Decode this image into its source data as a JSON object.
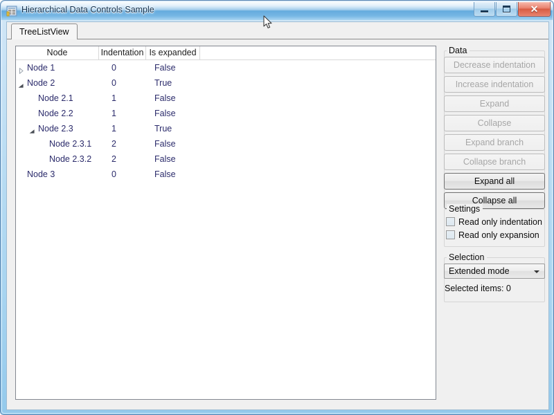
{
  "window": {
    "title": "Hierarchical Data Controls Sample",
    "icon": "table-grid-icon",
    "minimize_label": "",
    "maximize_label": "",
    "close_label": "✕"
  },
  "tabs": [
    {
      "label": "TreeListView",
      "selected": true
    }
  ],
  "treelist": {
    "columns": [
      "Node",
      "Indentation",
      "Is expanded"
    ],
    "rows": [
      {
        "label": "Node 1",
        "indentation": "0",
        "expanded": "False",
        "level": 0,
        "expander": "collapsed"
      },
      {
        "label": "Node 2",
        "indentation": "0",
        "expanded": "True",
        "level": 0,
        "expander": "expanded"
      },
      {
        "label": "Node 2.1",
        "indentation": "1",
        "expanded": "False",
        "level": 1,
        "expander": "none"
      },
      {
        "label": "Node 2.2",
        "indentation": "1",
        "expanded": "False",
        "level": 1,
        "expander": "none"
      },
      {
        "label": "Node 2.3",
        "indentation": "1",
        "expanded": "True",
        "level": 1,
        "expander": "expanded"
      },
      {
        "label": "Node 2.3.1",
        "indentation": "2",
        "expanded": "False",
        "level": 2,
        "expander": "none"
      },
      {
        "label": "Node 2.3.2",
        "indentation": "2",
        "expanded": "False",
        "level": 2,
        "expander": "none"
      },
      {
        "label": "Node 3",
        "indentation": "0",
        "expanded": "False",
        "level": 0,
        "expander": "none"
      }
    ]
  },
  "data_group": {
    "title": "Data",
    "buttons": [
      {
        "label": "Decrease indentation",
        "enabled": false
      },
      {
        "label": "Increase indentation",
        "enabled": false
      },
      {
        "label": "Expand",
        "enabled": false
      },
      {
        "label": "Collapse",
        "enabled": false
      },
      {
        "label": "Expand branch",
        "enabled": false
      },
      {
        "label": "Collapse branch",
        "enabled": false
      },
      {
        "label": "Expand all",
        "enabled": true
      },
      {
        "label": "Collapse all",
        "enabled": true
      }
    ]
  },
  "settings_group": {
    "title": "Settings",
    "checkboxes": [
      {
        "label": "Read only indentation",
        "checked": false
      },
      {
        "label": "Read only expansion",
        "checked": false
      }
    ]
  },
  "selection_group": {
    "title": "Selection",
    "mode": "Extended mode",
    "selected_items": "Selected items: 0"
  },
  "colors": {
    "node_text": "#2b2b6b",
    "title_text": "#12314f",
    "close_button": "#d85b42",
    "frame": "#5c87b2"
  }
}
